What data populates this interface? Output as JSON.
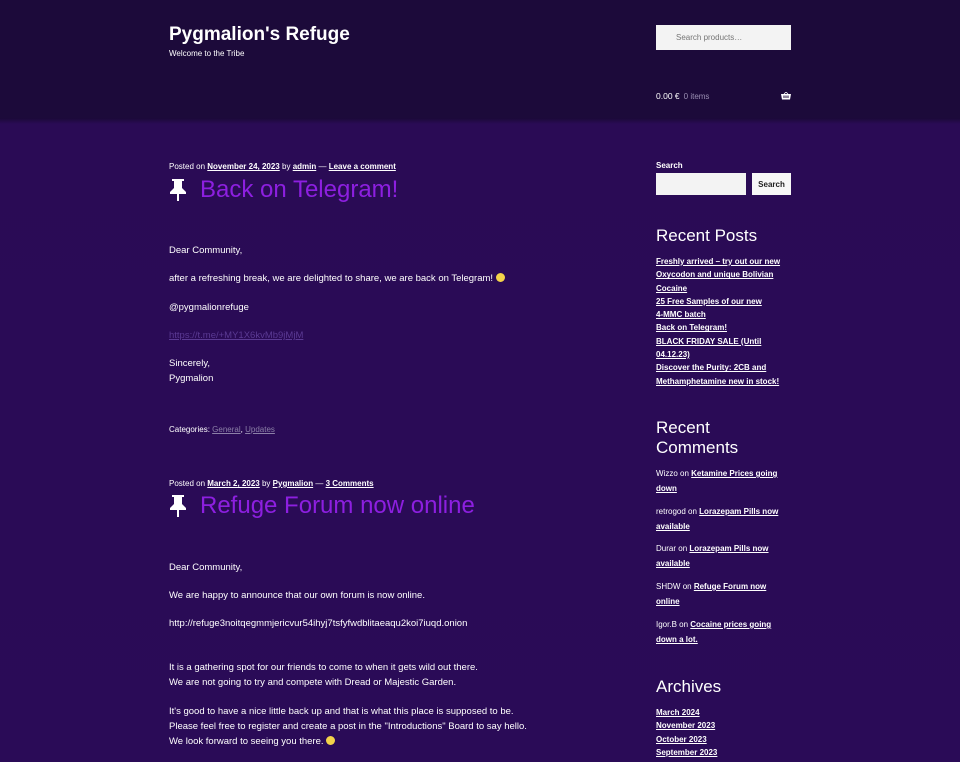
{
  "site": {
    "title": "Pygmalion's Refuge",
    "description": "Welcome to the Tribe",
    "search_placeholder": "Search products…"
  },
  "cart": {
    "total": "0.00 €",
    "items": "0 items"
  },
  "posts": [
    {
      "meta_prefix": "Posted on",
      "date": "November 24, 2023",
      "by": "by",
      "author": "admin",
      "sep": "—",
      "comments": "Leave a comment",
      "title": "Back on Telegram!",
      "p1": "Dear Community,",
      "p2": "after a refreshing break, we are delighted to share, we are back on Telegram!",
      "p3": "@pygmalionrefuge",
      "p4": "https://t.me/+MY1X6kvMb9jMjM",
      "p5a": "Sincerely,",
      "p5b": "Pygmalion",
      "cats_label": "Categories:",
      "cat1": "General",
      "cat_sep": ",",
      "cat2": "Updates"
    },
    {
      "meta_prefix": "Posted on",
      "date": "March 2, 2023",
      "by": "by",
      "author": "Pygmalion",
      "sep": "—",
      "comments": "3 Comments",
      "title": "Refuge Forum now online",
      "p1": "Dear Community,",
      "p2": "We are happy to announce that our own forum is now online.",
      "p3": "http://refuge3noitqegmmjericvur54ihyj7tsfyfwdblitaeaqu2koi7iuqd.onion",
      "p4a": "It is a gathering spot for our friends to come to when it gets wild out there.",
      "p4b": "We are not going to try and compete with Dread or Majestic Garden.",
      "p5a": "It's good to have a nice little back up and that is what this place is supposed to be.",
      "p5b": "Please feel free to register and create a post in the \"Introductions\" Board to say hello.",
      "p5c": "We look forward to seeing you there."
    }
  ],
  "sidebar": {
    "search_label": "Search",
    "search_button": "Search",
    "recent_posts_title": "Recent Posts",
    "recent_posts": [
      "Freshly arrived – try out our new",
      "Oxycodon and unique Bolivian",
      "Cocaine",
      "25 Free Samples of our new",
      "4-MMC batch",
      "Back on Telegram!",
      "BLACK FRIDAY SALE (Until",
      "04.12.23)",
      "Discover the Purity: 2CB and",
      "Methamphetamine new in stock!"
    ],
    "recent_comments_title_1": "Recent",
    "recent_comments_title_2": "Comments",
    "comments": [
      {
        "author": "Wizzo",
        "on": "on",
        "link1": "Ketamine Prices going",
        "link2": "down"
      },
      {
        "author": "retrogod",
        "on": "on",
        "link1": "Lorazepam Pills now",
        "link2": "available"
      },
      {
        "author": "Durar",
        "on": "on",
        "link1": "Lorazepam Pills now",
        "link2": "available"
      },
      {
        "author": "SHDW",
        "on": "on",
        "link1": "Refuge Forum now",
        "link2": "online"
      },
      {
        "author": "Igor.B",
        "on": "on",
        "link1": "Cocaine prices going",
        "link2": "down a lot."
      }
    ],
    "archives_title": "Archives",
    "archives": [
      "March 2024",
      "November 2023",
      "October 2023",
      "September 2023"
    ]
  }
}
